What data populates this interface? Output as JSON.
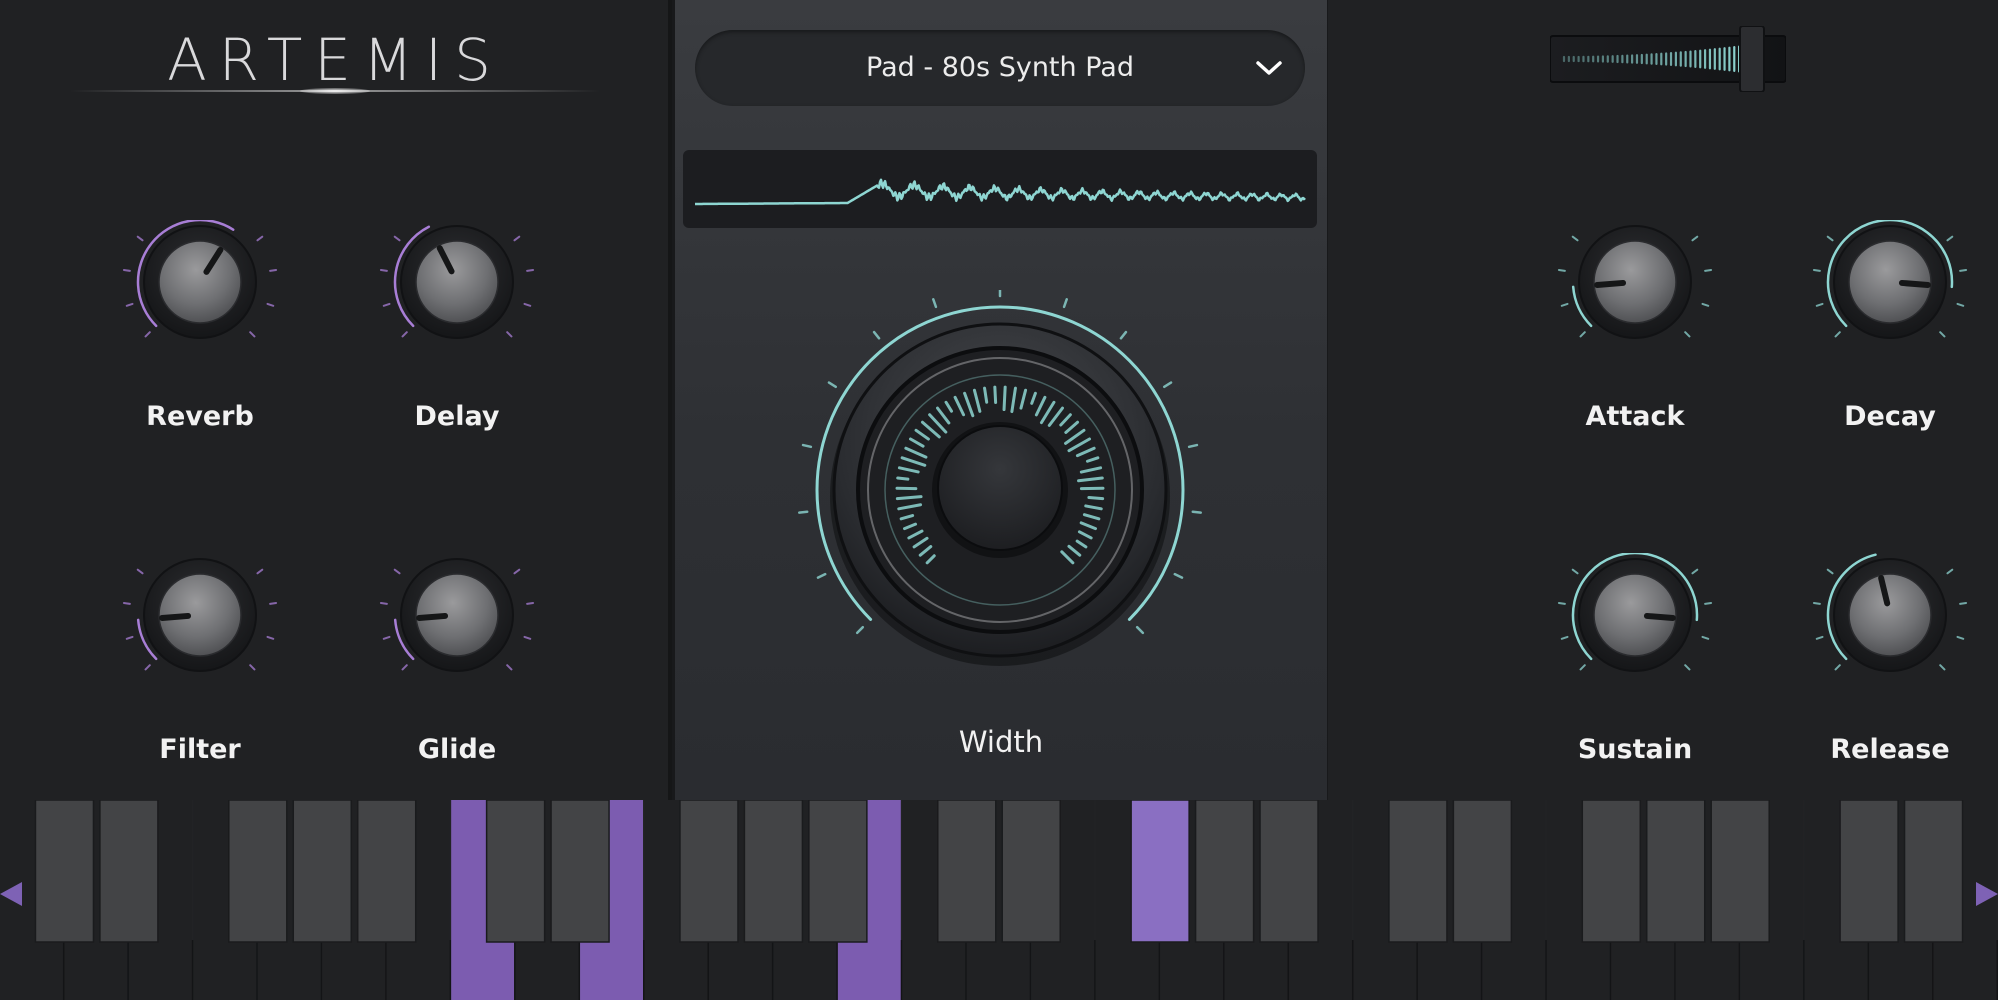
{
  "brand": {
    "name": "ARTEMIS"
  },
  "preset": {
    "name": "Pad - 80s Synth Pad"
  },
  "knobs": [
    {
      "id": "reverb",
      "label": "Reverb",
      "value": 0.62,
      "accent": "#a87ed6"
    },
    {
      "id": "delay",
      "label": "Delay",
      "value": 0.4,
      "accent": "#a87ed6"
    },
    {
      "id": "filter",
      "label": "Filter",
      "value": 0.15,
      "accent": "#a87ed6"
    },
    {
      "id": "glide",
      "label": "Glide",
      "value": 0.15,
      "accent": "#a87ed6"
    },
    {
      "id": "attack",
      "label": "Attack",
      "value": 0.15,
      "accent": "#8ed6d2"
    },
    {
      "id": "decay",
      "label": "Decay",
      "value": 0.85,
      "accent": "#8ed6d2"
    },
    {
      "id": "sustain",
      "label": "Sustain",
      "value": 0.85,
      "accent": "#8ed6d2"
    },
    {
      "id": "release",
      "label": "Release",
      "value": 0.45,
      "accent": "#8ed6d2"
    }
  ],
  "width_knob": {
    "label": "Width",
    "value": 1.0,
    "accent": "#8ed6d2"
  },
  "volume": {
    "value": 0.9
  },
  "keyboard": {
    "white_keys_count": 31,
    "pressed_white_keys": [
      7,
      9,
      13
    ],
    "pressed_black_keys": [
      12
    ],
    "active_color": "#7c5cb0"
  },
  "colors": {
    "purple_accent": "#a87ed6",
    "teal_accent": "#8ed6d2",
    "nav_arrow": "#7e62b5"
  },
  "icons": {
    "preset_dropdown": "chevron-down-icon",
    "keyboard_left": "triangle-left-icon",
    "keyboard_right": "triangle-right-icon"
  }
}
